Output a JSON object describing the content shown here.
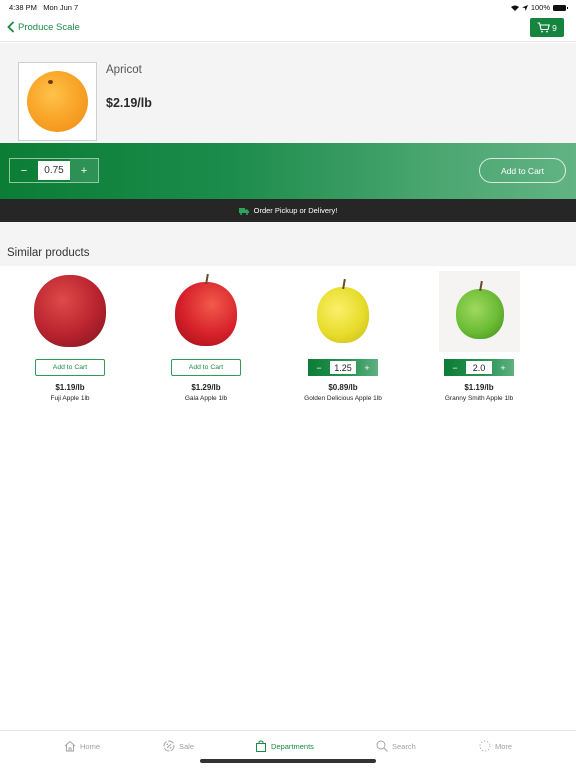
{
  "status_bar": {
    "time": "4:38 PM",
    "date": "Mon Jun 7",
    "battery": "100%"
  },
  "nav": {
    "back_label": "Produce Scale",
    "cart_count": "9"
  },
  "product": {
    "name": "Apricot",
    "price": "$2.19/lb",
    "quantity": "0.75",
    "add_to_cart": "Add to Cart",
    "minus": "−",
    "plus": "+"
  },
  "promo": {
    "text": "Order Pickup or Delivery!"
  },
  "similar": {
    "title": "Similar products",
    "items": [
      {
        "name": "Fuji Apple 1lb",
        "price": "$1.19/lb",
        "action": "Add to Cart",
        "quantity": null
      },
      {
        "name": "Gala Apple 1lb",
        "price": "$1.29/lb",
        "action": "Add to Cart",
        "quantity": null
      },
      {
        "name": "Golden Delicious Apple 1lb",
        "price": "$0.89/lb",
        "action": null,
        "quantity": "1.25"
      },
      {
        "name": "Granny Smith Apple 1lb",
        "price": "$1.19/lb",
        "action": null,
        "quantity": "2.0"
      }
    ]
  },
  "tabs": [
    {
      "label": "Home",
      "icon": "home-icon"
    },
    {
      "label": "Sale",
      "icon": "sale-icon"
    },
    {
      "label": "Departments",
      "icon": "bag-icon",
      "active": true
    },
    {
      "label": "Search",
      "icon": "search-icon"
    },
    {
      "label": "More",
      "icon": "more-icon"
    }
  ],
  "colors": {
    "brand_green": "#15843f",
    "promo_bg": "#262626"
  }
}
